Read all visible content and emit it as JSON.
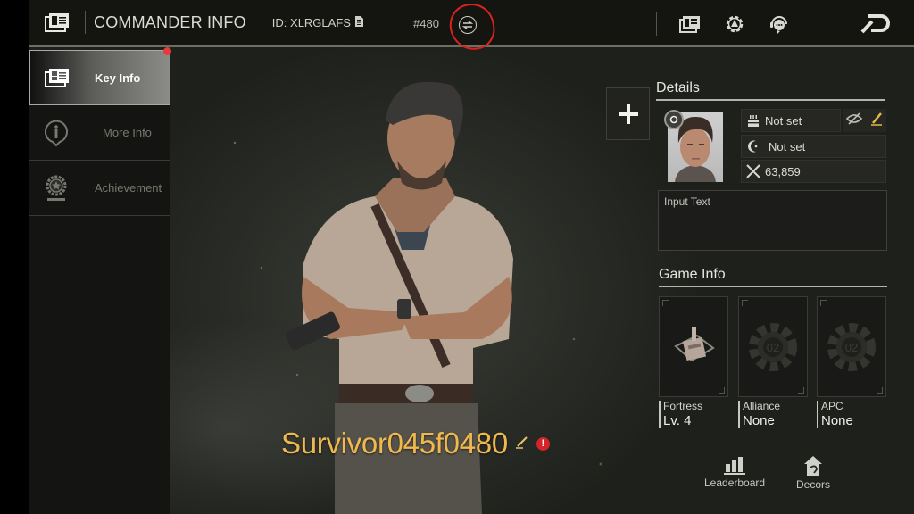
{
  "header": {
    "title": "COMMANDER INFO",
    "id_label": "ID: XLRGLAFS",
    "server": "#480",
    "icons": [
      "id-card-icon",
      "copy-icon",
      "swap-server-icon",
      "news-icon",
      "settings-icon",
      "support-icon",
      "back-icon"
    ]
  },
  "sidebar": {
    "tabs": [
      {
        "label": "Key Info",
        "icon": "id-card-icon",
        "active": true,
        "notification": true
      },
      {
        "label": "More Info",
        "icon": "info-icon",
        "active": false
      },
      {
        "label": "Achievement",
        "icon": "medal-icon",
        "active": false
      }
    ]
  },
  "player": {
    "name": "Survivor045f0480"
  },
  "details": {
    "title": "Details",
    "birthday": "Not set",
    "zodiac": "Not set",
    "power": "63,859",
    "bio_placeholder": "Input Text"
  },
  "game_info": {
    "title": "Game Info",
    "cards": [
      {
        "label": "Fortress",
        "value": "Lv. 4"
      },
      {
        "label": "Alliance",
        "value": "None"
      },
      {
        "label": "APC",
        "value": "None"
      }
    ]
  },
  "bottom": {
    "leaderboard": "Leaderboard",
    "decors": "Decors"
  },
  "colors": {
    "accent_name": "#f0b94e",
    "notification_red": "#e83a3a",
    "annotation_red": "#d8231f"
  }
}
